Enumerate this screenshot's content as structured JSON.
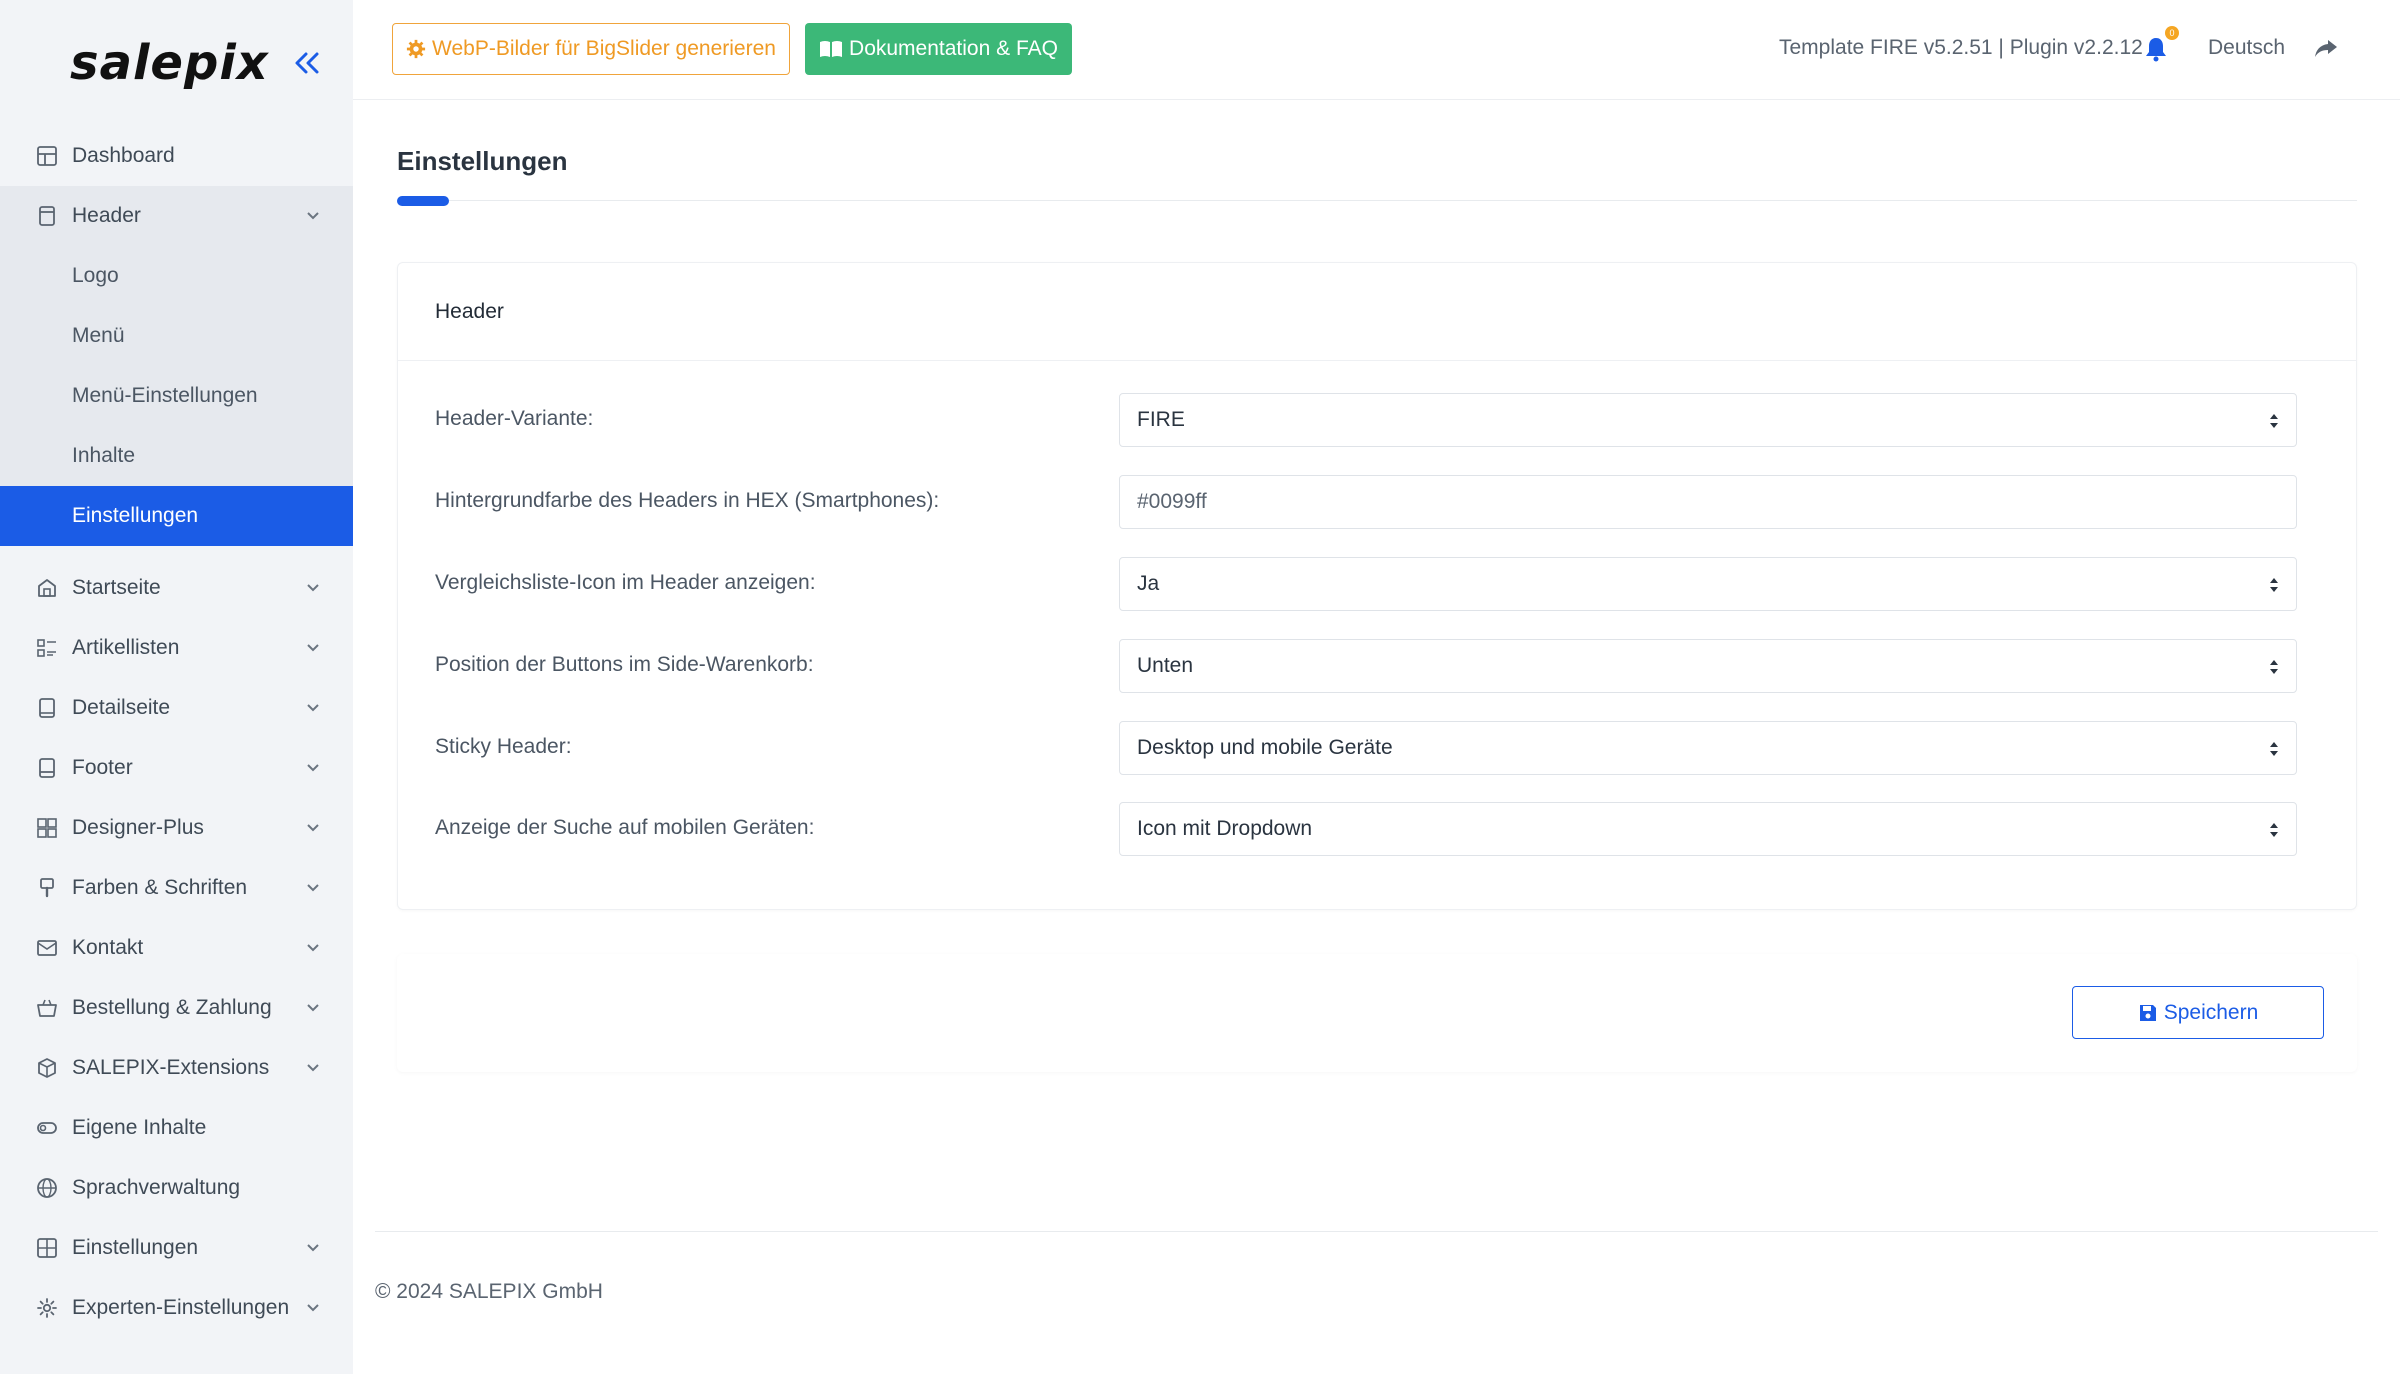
{
  "brand": {
    "name": "salepix"
  },
  "sidebar": {
    "items": [
      {
        "label": "Dashboard",
        "icon": "dashboard-icon"
      },
      {
        "label": "Header",
        "icon": "header-icon",
        "expanded": true,
        "children": [
          "Logo",
          "Menü",
          "Menü-Einstellungen",
          "Inhalte",
          "Einstellungen"
        ],
        "active_child": "Einstellungen"
      },
      {
        "label": "Startseite",
        "icon": "home-icon"
      },
      {
        "label": "Artikellisten",
        "icon": "list-icon"
      },
      {
        "label": "Detailseite",
        "icon": "tablet-icon"
      },
      {
        "label": "Footer",
        "icon": "footer-icon"
      },
      {
        "label": "Designer-Plus",
        "icon": "layout-icon"
      },
      {
        "label": "Farben & Schriften",
        "icon": "brush-icon"
      },
      {
        "label": "Kontakt",
        "icon": "mail-icon"
      },
      {
        "label": "Bestellung & Zahlung",
        "icon": "basket-icon"
      },
      {
        "label": "SALEPIX-Extensions",
        "icon": "package-icon"
      },
      {
        "label": "Eigene Inhalte",
        "icon": "toggle-icon"
      },
      {
        "label": "Sprachverwaltung",
        "icon": "globe-icon"
      },
      {
        "label": "Einstellungen",
        "icon": "grid-icon"
      },
      {
        "label": "Experten-Einstellungen",
        "icon": "gear-icon"
      }
    ]
  },
  "topbar": {
    "webp_button": "WebP-Bilder für BigSlider generieren",
    "docs_button": "Dokumentation & FAQ",
    "version": "Template FIRE v5.2.51 | Plugin v2.2.12",
    "notification_count": "0",
    "language": "Deutsch"
  },
  "page": {
    "title": "Einstellungen",
    "card_title": "Header",
    "fields": [
      {
        "label": "Header-Variante:",
        "type": "select",
        "value": "FIRE"
      },
      {
        "label": "Hintergrundfarbe des Headers in HEX (Smartphones):",
        "type": "input",
        "value": "#0099ff"
      },
      {
        "label": "Vergleichsliste-Icon im Header anzeigen:",
        "type": "select",
        "value": "Ja"
      },
      {
        "label": "Position der Buttons im Side-Warenkorb:",
        "type": "select",
        "value": "Unten"
      },
      {
        "label": "Sticky Header:",
        "type": "select",
        "value": "Desktop und mobile Geräte"
      },
      {
        "label": "Anzeige der Suche auf mobilen Geräten:",
        "type": "select",
        "value": "Icon mit Dropdown"
      }
    ],
    "save_button": "Speichern"
  },
  "footer": {
    "copyright": "© 2024 SALEPIX GmbH"
  },
  "colors": {
    "accent": "#1b5ce6",
    "warning": "#ef9a24",
    "success": "#3cb878",
    "sidebar_bg": "#f2f4f7"
  }
}
